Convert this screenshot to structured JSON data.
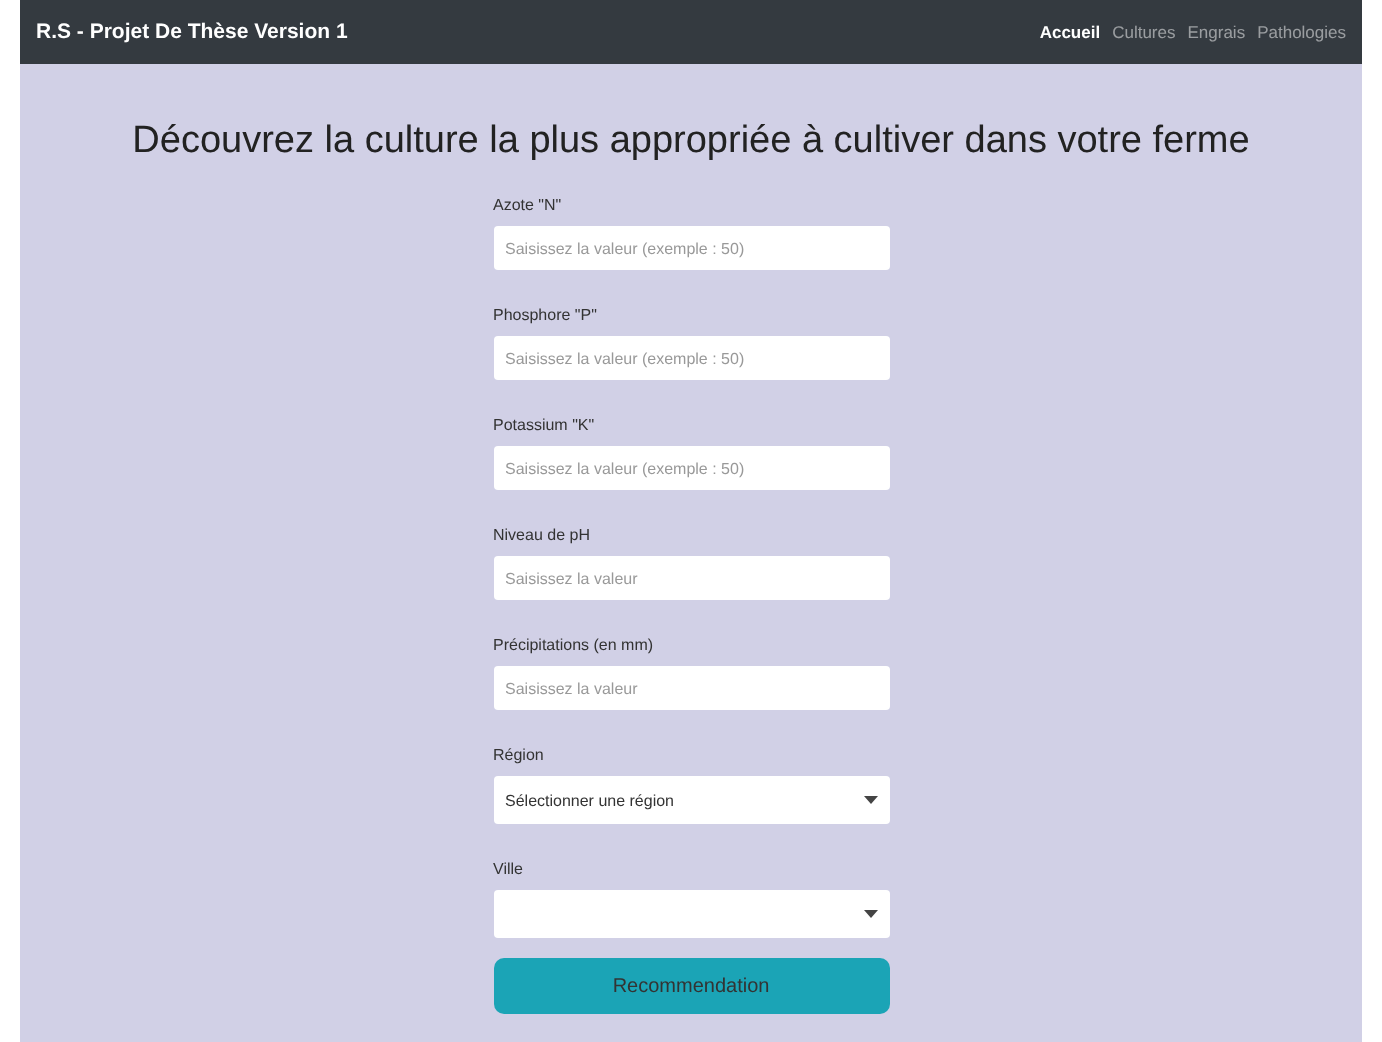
{
  "navbar": {
    "brand": "R.S - Projet De Thèse Version 1",
    "links": [
      {
        "label": "Accueil",
        "selected": true
      },
      {
        "label": "Cultures",
        "selected": false
      },
      {
        "label": "Engrais",
        "selected": false
      },
      {
        "label": "Pathologies",
        "selected": false
      }
    ]
  },
  "heading": "Découvrez la culture la plus appropriée à cultiver dans votre ferme",
  "fields": [
    {
      "kind": "input",
      "label": "Azote \"N\"",
      "placeholder": "Saisissez la valeur (exemple : 50)"
    },
    {
      "kind": "input",
      "label": "Phosphore \"P\"",
      "placeholder": "Saisissez la valeur (exemple : 50)"
    },
    {
      "kind": "input",
      "label": "Potassium \"K\"",
      "placeholder": "Saisissez la valeur (exemple : 50)"
    },
    {
      "kind": "input",
      "label": "Niveau de pH",
      "placeholder": "Saisissez la valeur"
    },
    {
      "kind": "input",
      "label": "Précipitations (en mm)",
      "placeholder": "Saisissez la valeur"
    },
    {
      "kind": "select",
      "label": "Région",
      "value": "Sélectionner une région"
    },
    {
      "kind": "select",
      "label": "Ville"
    }
  ],
  "submit": "Recommendation"
}
